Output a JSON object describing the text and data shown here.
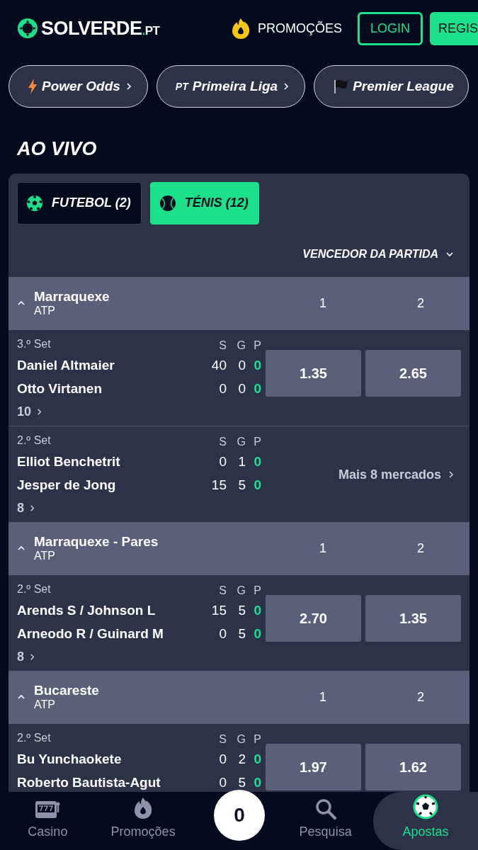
{
  "header": {
    "logo": {
      "name": "SOLVERDE",
      "suffix": ".PT"
    },
    "promotions": "PROMOÇÕES",
    "login": "LOGIN",
    "register": "REGIS"
  },
  "chips": [
    {
      "kind": "bolt",
      "label": "Power Odds"
    },
    {
      "kind": "country",
      "label": "Primeira Liga",
      "prefix": "PT"
    },
    {
      "kind": "flag",
      "label": "Premier League"
    }
  ],
  "section_title": "AO VIVO",
  "sport_tabs": [
    {
      "kind": "football",
      "label": "FUTEBOL (2)",
      "selected": false
    },
    {
      "kind": "tennis",
      "label": "TÉNIS (12)",
      "selected": true
    }
  ],
  "market_selector": "VENCEDOR DA PARTIDA",
  "groups": [
    {
      "name": "Marraquexe",
      "subtitle": "ATP",
      "expanded": true,
      "columns": [
        "1",
        "2"
      ],
      "matches": [
        {
          "set": "3.º Set",
          "headers": [
            "S",
            "G",
            "P"
          ],
          "players": [
            {
              "name": "Daniel Altmaier",
              "scores": [
                "40",
                "0",
                "0"
              ]
            },
            {
              "name": "Otto Virtanen",
              "scores": [
                "0",
                "0",
                "0"
              ]
            }
          ],
          "markets": "10",
          "kind": "odds",
          "odds": [
            "1.35",
            "2.65"
          ]
        },
        {
          "set": "2.º Set",
          "headers": [
            "S",
            "G",
            "P"
          ],
          "players": [
            {
              "name": "Elliot Benchetrit",
              "scores": [
                "0",
                "1",
                "0"
              ]
            },
            {
              "name": "Jesper de Jong",
              "scores": [
                "15",
                "5",
                "0"
              ]
            }
          ],
          "markets": "8",
          "kind": "more",
          "more": "Mais 8 mercados"
        }
      ]
    },
    {
      "name": "Marraquexe - Pares",
      "subtitle": "ATP",
      "expanded": true,
      "columns": [
        "1",
        "2"
      ],
      "matches": [
        {
          "set": "2.º Set",
          "headers": [
            "S",
            "G",
            "P"
          ],
          "players": [
            {
              "name": "Arends S / Johnson L",
              "scores": [
                "15",
                "5",
                "0"
              ]
            },
            {
              "name": "Arneodo R / Guinard M",
              "scores": [
                "0",
                "5",
                "0"
              ]
            }
          ],
          "markets": "8",
          "kind": "odds",
          "odds": [
            "2.70",
            "1.35"
          ]
        }
      ]
    },
    {
      "name": "Bucareste",
      "subtitle": "ATP",
      "expanded": true,
      "columns": [
        "1",
        "2"
      ],
      "matches": [
        {
          "set": "2.º Set",
          "headers": [
            "S",
            "G",
            "P"
          ],
          "players": [
            {
              "name": "Bu Yunchaokete",
              "scores": [
                "0",
                "2",
                "0"
              ]
            },
            {
              "name": "Roberto Bautista-Agut",
              "scores": [
                "0",
                "5",
                "0"
              ]
            }
          ],
          "kind": "odds",
          "odds": [
            "1.97",
            "1.62"
          ]
        }
      ]
    }
  ],
  "bottom_nav": [
    {
      "kind": "casino",
      "label": "Casino",
      "selected": false
    },
    {
      "kind": "promo",
      "label": "Promoções",
      "selected": false
    },
    {
      "kind": "betslip",
      "count": "0",
      "selected": false
    },
    {
      "kind": "search",
      "label": "Pesquisa",
      "selected": false
    },
    {
      "kind": "sports",
      "label": "Apostas",
      "selected": true
    }
  ]
}
